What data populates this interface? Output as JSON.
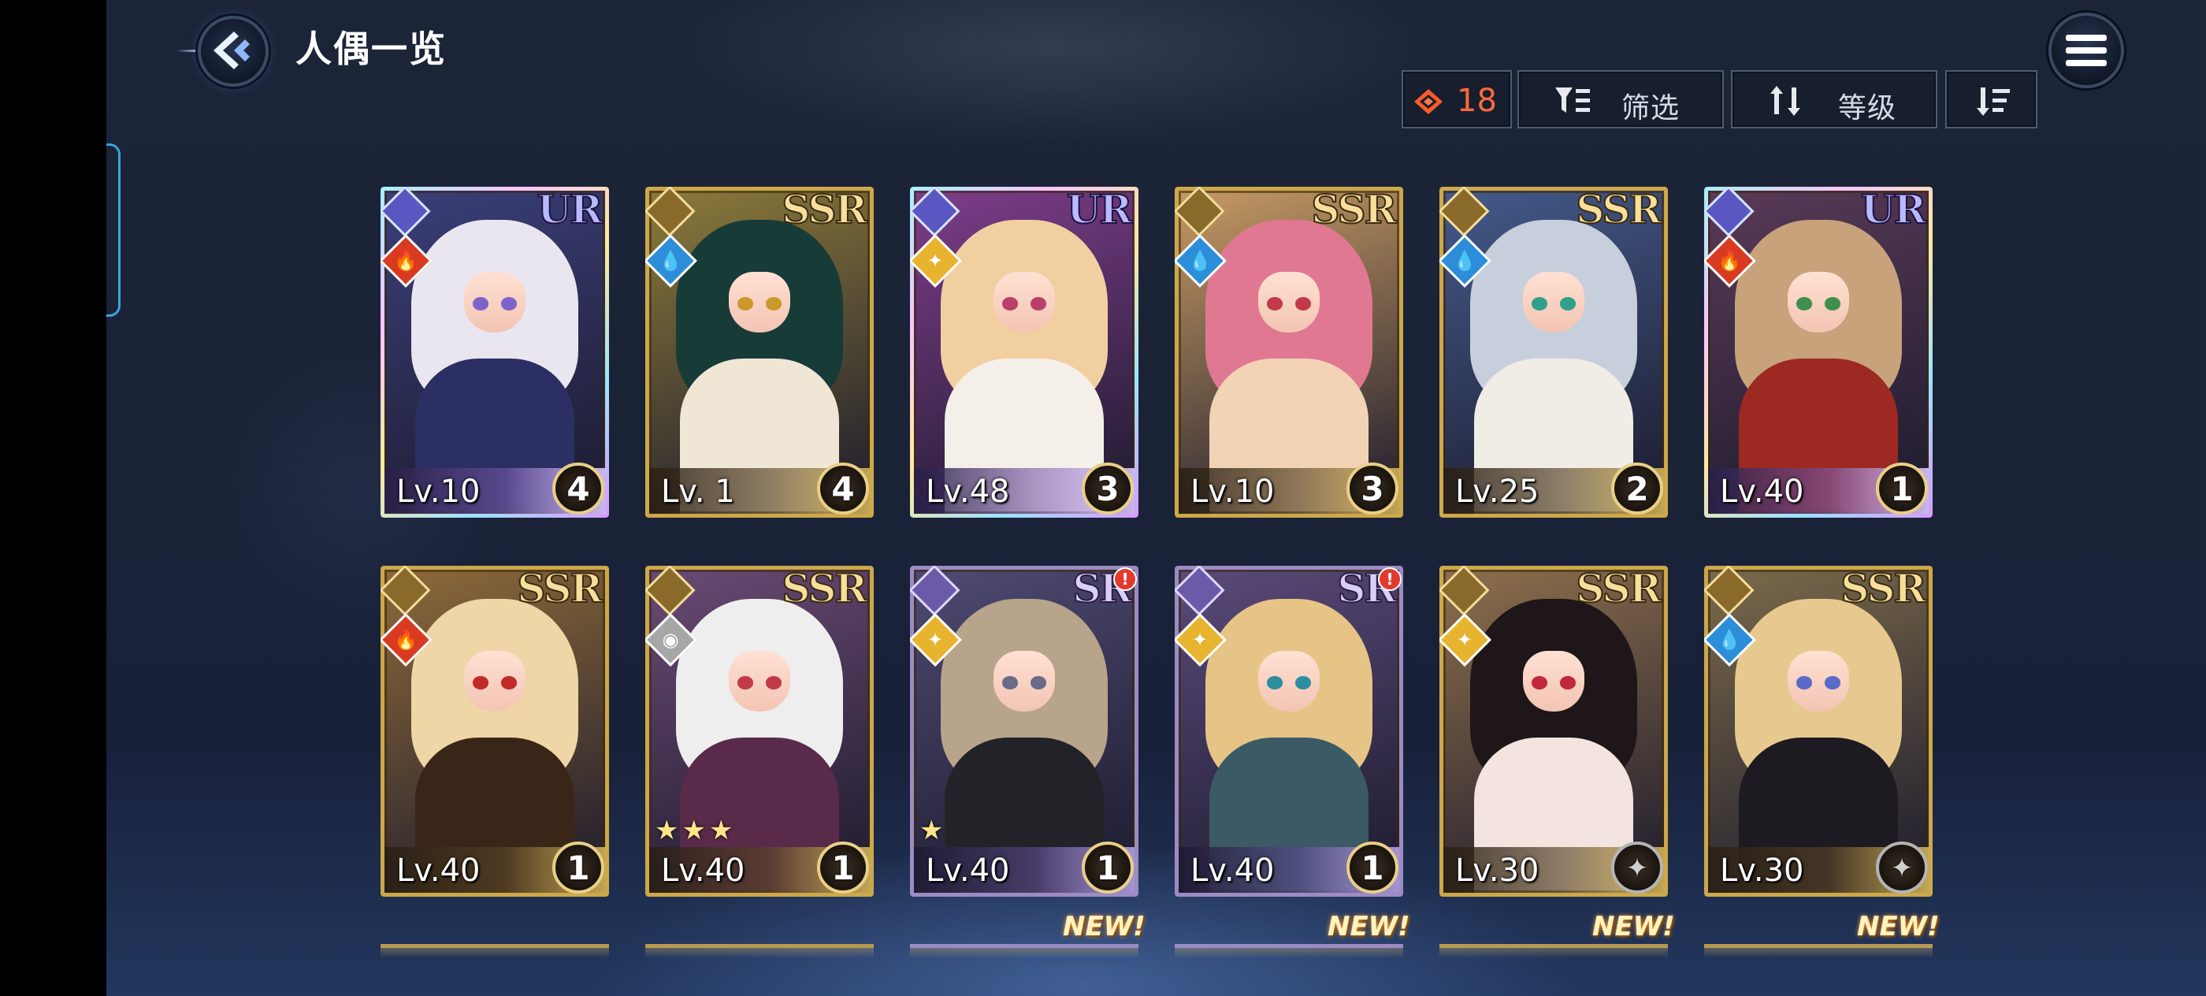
{
  "header": {
    "title": "人偶一览"
  },
  "toolbar": {
    "gem_count": "18",
    "filter_label": "筛选",
    "sort_label": "等级"
  },
  "colors": {
    "accent": "#ff6a3d",
    "gold_frame": "#cda84a",
    "sr_frame": "#9c8bc4"
  },
  "cards": [
    {
      "rarity": "UR",
      "level": "Lv.10",
      "rank": "4",
      "element": "fire",
      "hair": "#e9e6f0",
      "outfit": "#2b2f63",
      "eye": "#7c63c9",
      "bg": "#3b3f7a"
    },
    {
      "rarity": "SSR",
      "level": "Lv. 1",
      "rank": "4",
      "element": "water",
      "hair": "#173b36",
      "outfit": "#efe6d6",
      "eye": "#c99a2a",
      "bg": "#8c7a3a"
    },
    {
      "rarity": "UR",
      "level": "Lv.48",
      "rank": "3",
      "element": "light",
      "hair": "#f2cfa0",
      "outfit": "#f4efe8",
      "eye": "#b9406a",
      "bg": "#7e3d8a"
    },
    {
      "rarity": "SSR",
      "level": "Lv.10",
      "rank": "3",
      "element": "water",
      "hair": "#e07892",
      "outfit": "#f2d3b5",
      "eye": "#c23a4a",
      "bg": "#c69a63"
    },
    {
      "rarity": "SSR",
      "level": "Lv.25",
      "rank": "2",
      "element": "water",
      "hair": "#c7cfdc",
      "outfit": "#f0ece6",
      "eye": "#2fa08c",
      "bg": "#445a8a"
    },
    {
      "rarity": "UR",
      "level": "Lv.40",
      "rank": "1",
      "element": "fire",
      "hair": "#c8a27a",
      "outfit": "#9c2a22",
      "eye": "#3f8f4e",
      "bg": "#5a3a58"
    },
    {
      "rarity": "SSR",
      "level": "Lv.40",
      "rank": "1",
      "element": "fire",
      "hair": "#eed6a6",
      "outfit": "#3a2618",
      "eye": "#c22a2a",
      "bg": "#8e6a3a"
    },
    {
      "rarity": "SSR",
      "level": "Lv.40",
      "rank": "1",
      "element": "dark",
      "hair": "#eeeeee",
      "outfit": "#5a2a4a",
      "eye": "#c23a4a",
      "bg": "#6b4a74",
      "stars": "★★★"
    },
    {
      "rarity": "SR",
      "level": "Lv.40",
      "rank": "1",
      "element": "light",
      "hair": "#b7a48a",
      "outfit": "#232228",
      "eye": "#6a6a8a",
      "bg": "#4f4a72",
      "stars": "★",
      "alert": "!"
    },
    {
      "rarity": "SR",
      "level": "Lv.40",
      "rank": "1",
      "element": "light",
      "hair": "#e6c485",
      "outfit": "#3b5a66",
      "eye": "#2d8ea0",
      "bg": "#5b4a7a",
      "alert": "!"
    },
    {
      "rarity": "SSR",
      "level": "Lv.30",
      "rank": "",
      "element": "light",
      "hair": "#1e1618",
      "outfit": "#f4e4e0",
      "eye": "#c2283a",
      "bg": "#8e6f4c"
    },
    {
      "rarity": "SSR",
      "level": "Lv.30",
      "rank": "",
      "element": "water",
      "hair": "#e7c98f",
      "outfit": "#1e1a22",
      "eye": "#5a6ac8",
      "bg": "#7b6a4a"
    }
  ],
  "new_labels": [
    "NEW!",
    "NEW!",
    "NEW!",
    "NEW!"
  ]
}
